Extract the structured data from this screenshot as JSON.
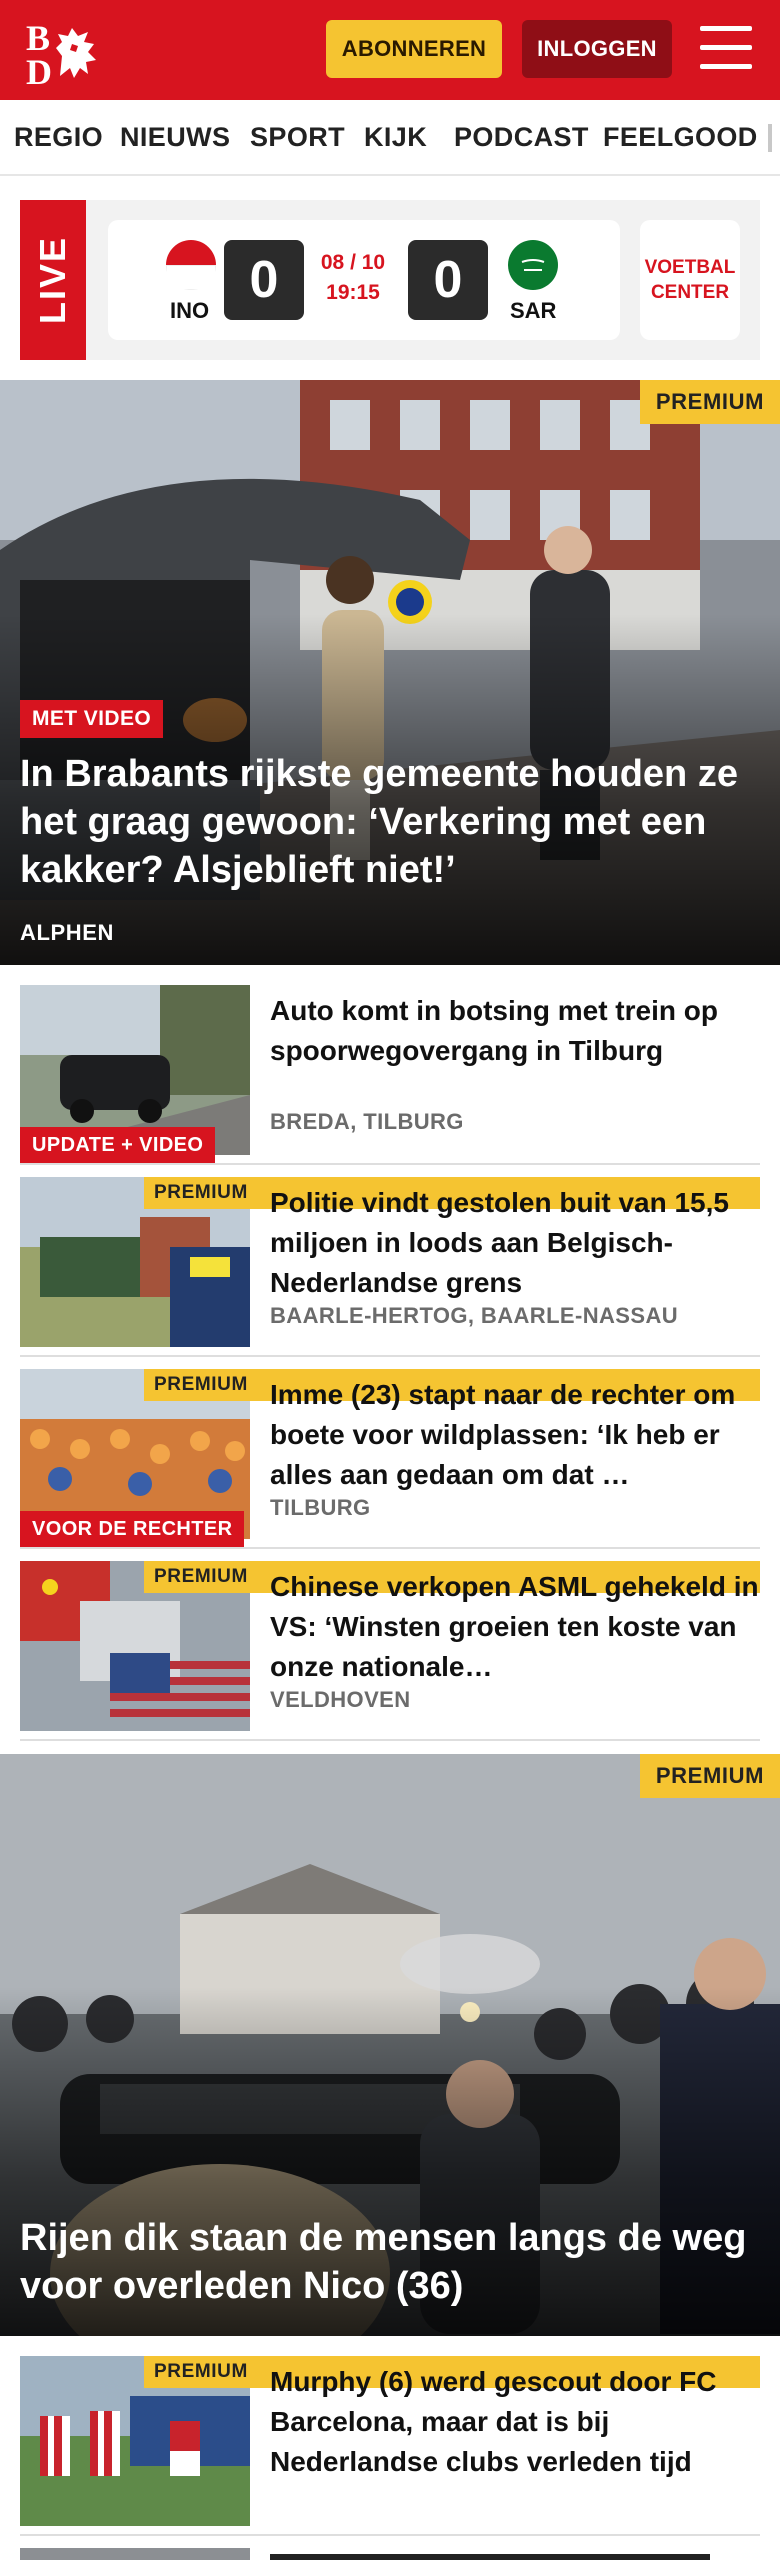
{
  "header": {
    "logo_text": "BD",
    "subscribe_label": "ABONNEREN",
    "login_label": "INLOGGEN",
    "brand_color": "#d7141f"
  },
  "nav": {
    "items": [
      {
        "label": "REGIO"
      },
      {
        "label": "NIEUWS"
      },
      {
        "label": "SPORT"
      },
      {
        "label": "KIJK"
      },
      {
        "label": "PODCAST"
      },
      {
        "label": "FEELGOOD"
      }
    ]
  },
  "live": {
    "label": "LIVE",
    "home_code": "INO",
    "away_code": "SAR",
    "home_score": "0",
    "away_score": "0",
    "date": "08 / 10",
    "time": "19:15",
    "center_label": "VOETBAL CENTER"
  },
  "hero1": {
    "premium": "PREMIUM",
    "tag": "MET VIDEO",
    "title": "In Brabants rijkste gemeente houden ze het graag gewoon: ‘Verkering met een kakker? Alsjeblieft niet!’",
    "location": "ALPHEN"
  },
  "list1": [
    {
      "title": "Auto komt in botsing met trein op spoorwegovergang in Tilburg",
      "location": "BREDA, TILBURG",
      "tag": "UPDATE + VIDEO",
      "premium": ""
    },
    {
      "title": "Politie vindt gestolen buit van 15,5 miljoen in loods aan Bel­gisch-Nederlandse grens",
      "location": "BAARLE-HERTOG, BAARLE-NASSAU",
      "tag": "",
      "premium": "PREMIUM"
    },
    {
      "title": "Imme (23) stapt naar de rechter om boete voor wildplassen: ‘Ik heb er alles aan gedaan om dat …",
      "location": "TILBURG",
      "tag": "VOOR DE RECHTER",
      "premium": "PREMIUM"
    },
    {
      "title": "Chinese verkopen ASML gehekeld in VS: ‘Winsten groeien ten koste van onze nationale…",
      "location": "VELDHOVEN",
      "tag": "",
      "premium": "PREMIUM"
    }
  ],
  "hero2": {
    "premium": "PREMIUM",
    "title": "Rijen dik staan de mensen langs de weg voor overleden Nico (36)"
  },
  "list2": [
    {
      "title": "Murphy (6) werd gescout door FC Barcelona, maar dat is bij Nederlandse clubs verleden tijd",
      "premium": "PREMIUM"
    }
  ]
}
